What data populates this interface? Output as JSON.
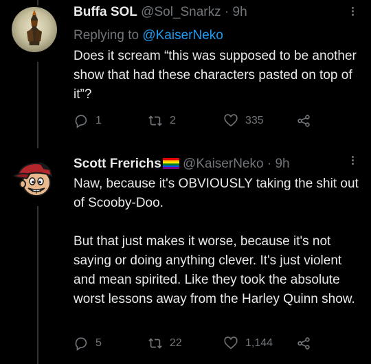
{
  "tweets": [
    {
      "name": "Buffa SOL",
      "handle": "@Sol_Snarkz",
      "separator": "·",
      "time": "9h",
      "reply_prefix": "Replying to ",
      "reply_mention": "@KaiserNeko",
      "text": "Does it scream “this was supposed to be another show that had these characters pasted on top of it”?",
      "replies": "1",
      "retweets": "2",
      "likes": "335"
    },
    {
      "name": "Scott Frerichs",
      "handle": "@KaiserNeko",
      "separator": "·",
      "time": "9h",
      "text": "Naw, because it's OBVIOUSLY taking the shit out of Scooby-Doo.\n\nBut that just makes it worse, because it's not saying or doing anything clever. It's just violent and mean spirited. Like they took the absolute worst lessons away from the Harley Quinn show.",
      "replies": "5",
      "retweets": "22",
      "likes": "1,144"
    }
  ],
  "icons": {
    "reply": "reply-icon",
    "retweet": "retweet-icon",
    "like": "heart-icon",
    "share": "share-icon",
    "more": "more-icon",
    "flag": "pride-flag-icon"
  },
  "colors": {
    "background": "#000000",
    "text": "#e7e9ea",
    "muted": "#71767b",
    "link": "#1d9bf0"
  }
}
